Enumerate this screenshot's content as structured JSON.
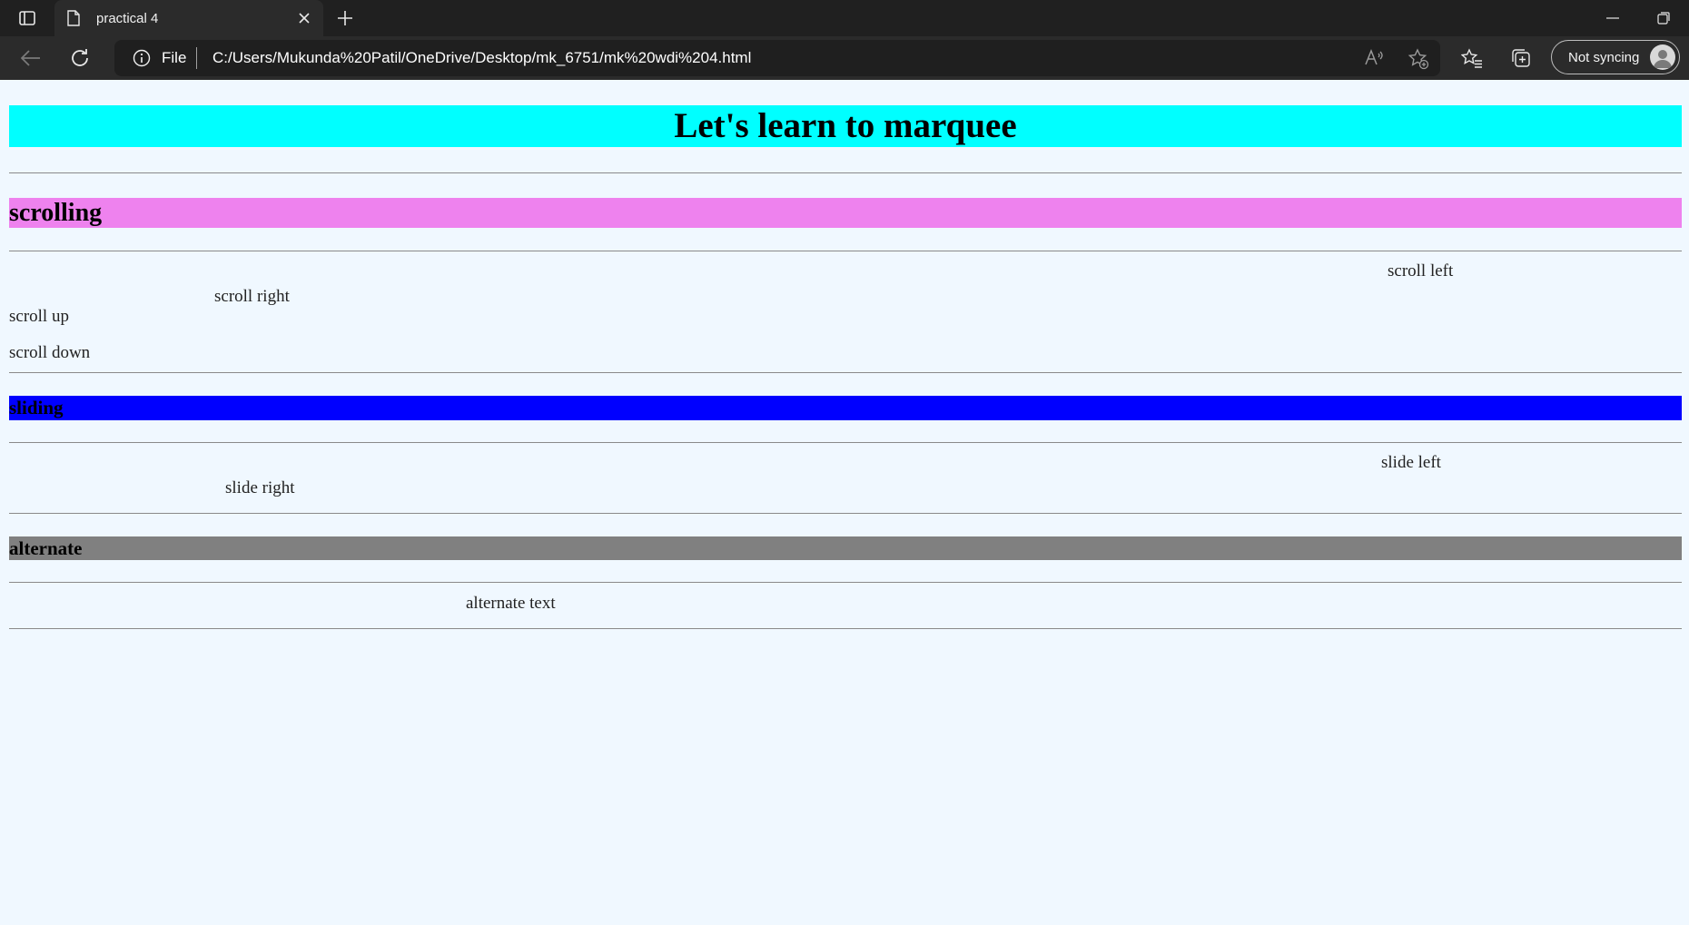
{
  "browser": {
    "tab_title": "practical 4",
    "address": {
      "scheme": "File",
      "url": "C:/Users/Mukunda%20Patil/OneDrive/Desktop/mk_6751/mk%20wdi%204.html"
    },
    "sync_label": "Not syncing",
    "icons": [
      "tab-actions-icon",
      "file-icon",
      "close-icon",
      "plus-icon",
      "back-icon",
      "reload-icon",
      "info-icon",
      "read-aloud-icon",
      "add-favorite-icon",
      "favorites-icon",
      "collections-icon",
      "profile-avatar",
      "minimize-icon",
      "restore-icon"
    ]
  },
  "page": {
    "heading": "Let's learn to marquee",
    "sections": {
      "scrolling": {
        "title": "scrolling",
        "items": [
          "scroll left",
          "scroll right",
          "scroll up",
          "scroll down"
        ]
      },
      "sliding": {
        "title": "sliding",
        "items": [
          "slide left",
          "slide right"
        ]
      },
      "alternate": {
        "title": "alternate",
        "items": [
          "alternate text"
        ]
      }
    },
    "colors": {
      "background": "#f0f8ff",
      "heading_bg": "#00ffff",
      "scrolling_bg": "#ee82ee",
      "sliding_bg": "#0000ff",
      "alternate_bg": "#808080"
    }
  }
}
